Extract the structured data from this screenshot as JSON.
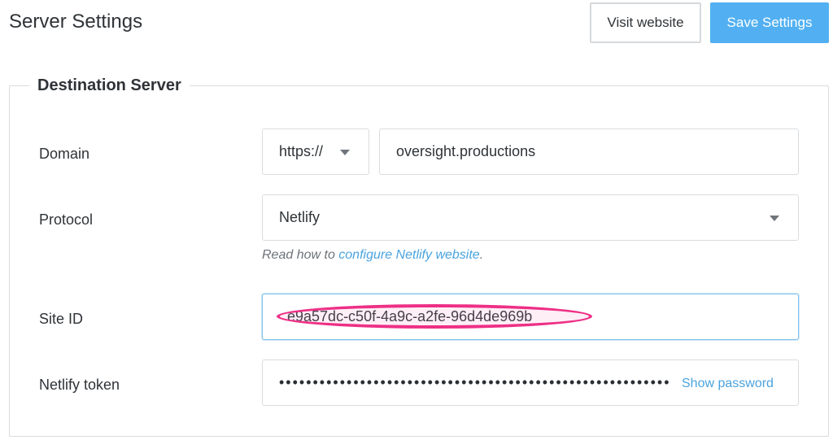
{
  "header": {
    "title": "Server Settings",
    "visit_label": "Visit website",
    "save_label": "Save Settings"
  },
  "section": {
    "legend": "Destination Server"
  },
  "domain": {
    "label": "Domain",
    "scheme_value": "https://",
    "host_value": "oversight.productions"
  },
  "protocol": {
    "label": "Protocol",
    "value": "Netlify",
    "help_prefix": "Read how to ",
    "help_link": "configure Netlify website",
    "help_suffix": "."
  },
  "site_id": {
    "label": "Site ID",
    "value": "e9a57dc-c50f-4a9c-a2fe-96d4de969b"
  },
  "token": {
    "label": "Netlify token",
    "masked_value": "••••••••••••••••••••••••••••••••••••••••••••••••••••••••••",
    "show_label": "Show password"
  },
  "colors": {
    "accent": "#52b0f2",
    "link": "#4aa3df",
    "redaction": "#ee2f86"
  }
}
